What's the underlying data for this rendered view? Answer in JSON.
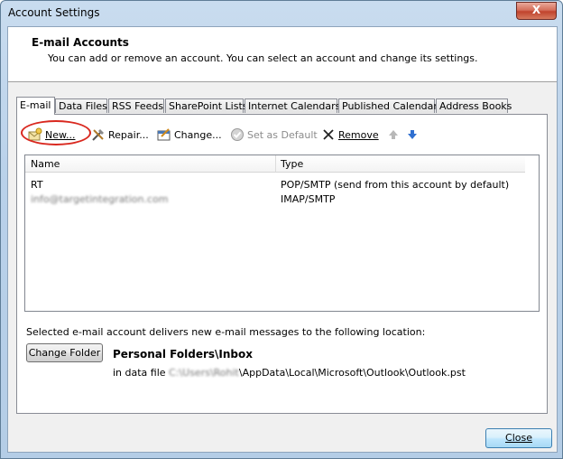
{
  "window": {
    "title": "Account Settings",
    "close_glyph": "X"
  },
  "header": {
    "title": "E-mail Accounts",
    "description": "You can add or remove an account. You can select an account and change its settings."
  },
  "tabs": [
    {
      "label": "E-mail",
      "active": true
    },
    {
      "label": "Data Files"
    },
    {
      "label": "RSS Feeds"
    },
    {
      "label": "SharePoint Lists"
    },
    {
      "label": "Internet Calendars"
    },
    {
      "label": "Published Calendars"
    },
    {
      "label": "Address Books"
    }
  ],
  "toolbar": {
    "new_label": "New...",
    "repair_label": "Repair...",
    "change_label": "Change...",
    "set_default_label": "Set as Default",
    "remove_label": "Remove",
    "icons": {
      "new": "new-account-icon",
      "repair": "tools-icon",
      "change": "change-account-icon",
      "set_default": "checkmark-icon",
      "remove": "remove-x-icon",
      "up": "move-up-arrow-icon",
      "down": "move-down-arrow-icon"
    },
    "highlight_color": "#d9281f"
  },
  "account_list": {
    "columns": [
      "Name",
      "Type"
    ],
    "rows": [
      {
        "name": "RT",
        "type": "POP/SMTP (send from this account by default)"
      },
      {
        "name": "info@targetintegration.com",
        "type": "IMAP/SMTP",
        "name_blurred": true
      }
    ]
  },
  "delivery": {
    "text": "Selected e-mail account delivers new e-mail messages to the following location:",
    "change_folder_label": "Change Folder",
    "folder": "Personal Folders\\Inbox",
    "datafile_prefix": "in data file ",
    "datafile_blurred_part": "C:\\Users\\Rohit",
    "datafile_path": "\\AppData\\Local\\Microsoft\\Outlook\\Outlook.pst"
  },
  "footer": {
    "close_label": "Close"
  }
}
